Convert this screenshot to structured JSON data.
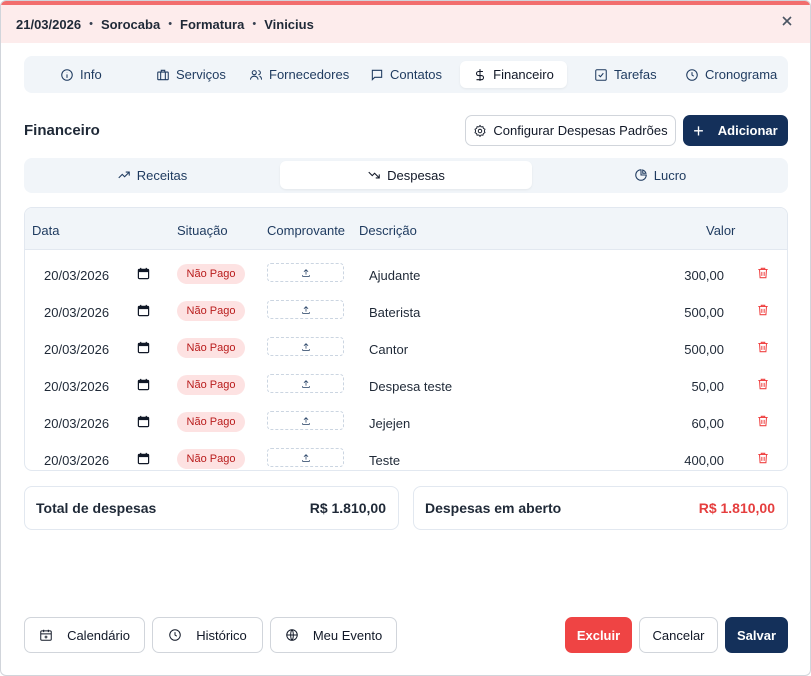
{
  "header": {
    "date": "21/03/2026",
    "city": "Sorocaba",
    "event_type": "Formatura",
    "client": "Vinicius"
  },
  "tabs": [
    {
      "label": "Info",
      "icon": "info-icon"
    },
    {
      "label": "Serviços",
      "icon": "services-icon"
    },
    {
      "label": "Fornecedores",
      "icon": "users-icon"
    },
    {
      "label": "Contatos",
      "icon": "message-icon"
    },
    {
      "label": "Financeiro",
      "icon": "dollar-icon",
      "active": true
    },
    {
      "label": "Tarefas",
      "icon": "checkbox-icon"
    },
    {
      "label": "Cronograma",
      "icon": "clock-icon"
    }
  ],
  "section": {
    "title": "Financeiro",
    "config_label": "Configurar Despesas Padrões",
    "add_label": "Adicionar"
  },
  "subtabs": [
    {
      "label": "Receitas",
      "icon": "trending-up-icon"
    },
    {
      "label": "Despesas",
      "icon": "trending-down-icon",
      "active": true
    },
    {
      "label": "Lucro",
      "icon": "pie-chart-icon"
    }
  ],
  "table": {
    "headers": {
      "date": "Data",
      "status": "Situação",
      "receipt": "Comprovante",
      "description": "Descrição",
      "value": "Valor"
    },
    "rows": [
      {
        "date": "20/03/2026",
        "status": "Não Pago",
        "description": "Ajudante",
        "value": "300,00"
      },
      {
        "date": "20/03/2026",
        "status": "Não Pago",
        "description": "Baterista",
        "value": "500,00"
      },
      {
        "date": "20/03/2026",
        "status": "Não Pago",
        "description": "Cantor",
        "value": "500,00"
      },
      {
        "date": "20/03/2026",
        "status": "Não Pago",
        "description": "Despesa teste",
        "value": "50,00"
      },
      {
        "date": "20/03/2026",
        "status": "Não Pago",
        "description": "Jejejen",
        "value": "60,00"
      },
      {
        "date": "20/03/2026",
        "status": "Não Pago",
        "description": "Teste",
        "value": "400,00"
      }
    ]
  },
  "totals": {
    "total_label": "Total de despesas",
    "total_value": "R$ 1.810,00",
    "open_label": "Despesas em aberto",
    "open_value": "R$ 1.810,00"
  },
  "footer": {
    "calendar_label": "Calendário",
    "history_label": "Histórico",
    "my_event_label": "Meu Evento",
    "delete_label": "Excluir",
    "cancel_label": "Cancelar",
    "save_label": "Salvar"
  },
  "colors": {
    "primary": "#14305a",
    "danger": "#ef4444",
    "header_bg": "#fdecec",
    "header_accent": "#f26d6d",
    "badge_bg": "#fde2e2"
  }
}
